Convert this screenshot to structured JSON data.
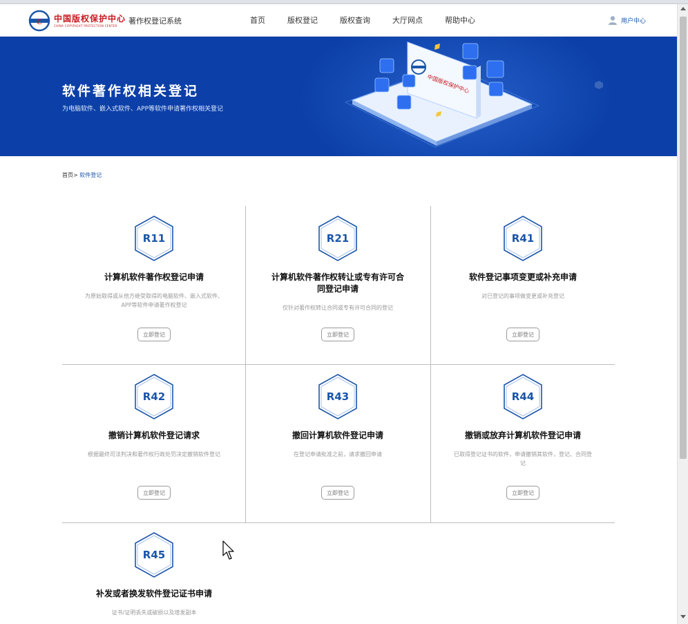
{
  "header": {
    "logo_cn": "中国版权保护中心",
    "logo_en": "CHINA COPYRIGHT PROTECTION CENTER",
    "system_name": "著作权登记系统",
    "nav": [
      "首页",
      "版权登记",
      "版权查询",
      "大厅网点",
      "帮助中心"
    ],
    "user_center": "用户中心"
  },
  "banner": {
    "title": "软件著作权相关登记",
    "subtitle": "为电脑软件、嵌入式软件、APP等软件申请著作权相关登记",
    "board_text": "中国版权保护中心"
  },
  "breadcrumb": {
    "home": "首页",
    "separator": ">",
    "current": "软件登记"
  },
  "cards": [
    {
      "code": "R11",
      "title": "计算机软件著作权登记申请",
      "desc": "为原始取得或从他方继受取得的电脑软件、嵌入式软件、APP等软件申请著作权登记",
      "button": "立即登记"
    },
    {
      "code": "R21",
      "title": "计算机软件著作权转让或专有许可合同登记申请",
      "desc": "仅针对著作权转让合同或专有许可合同的登记",
      "button": "立即登记"
    },
    {
      "code": "R41",
      "title": "软件登记事项变更或补充申请",
      "desc": "对已登记的事项做变更或补充登记",
      "button": "立即登记"
    },
    {
      "code": "R42",
      "title": "撤销计算机软件登记请求",
      "desc": "根据最终司法判决和著作权行政处罚决定撤销软件登记",
      "button": "立即登记"
    },
    {
      "code": "R43",
      "title": "撤回计算机软件登记申请",
      "desc": "在登记申请批准之前，请求撤回申请",
      "button": "立即登记"
    },
    {
      "code": "R44",
      "title": "撤销或放弃计算机软件登记申请",
      "desc": "已取得登记证书的软件，申请撤销其软件，登记、合同登记",
      "button": "立即登记"
    },
    {
      "code": "R45",
      "title": "补发或者换发软件登记证书申请",
      "desc": "证书/证明丢失或破损以及增发副本",
      "button": ""
    }
  ],
  "colors": {
    "brand_blue": "#0c40a8",
    "accent_blue": "#1b55a8",
    "logo_red": "#c8191f"
  }
}
